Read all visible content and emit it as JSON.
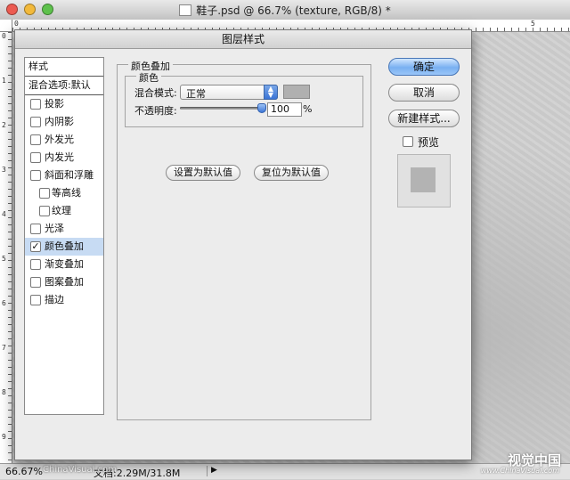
{
  "window": {
    "title": "鞋子.psd @ 66.7% (texture, RGB/8) *",
    "close_color": "#ec5b51",
    "minimize_color": "#f2b93b",
    "zoom_color": "#5ec14c"
  },
  "rulers": {
    "top_labels": [
      "0",
      "5"
    ],
    "left_labels": [
      "0",
      "1",
      "2",
      "3",
      "4",
      "5",
      "6",
      "7",
      "8",
      "9"
    ]
  },
  "status_bar": {
    "zoom": "66.67%",
    "doc_info": "文档:2.29M/31.8M",
    "arrow": "▶"
  },
  "watermarks": {
    "brand": "视觉中国",
    "url": "www.ChinaVisual.com",
    "small": "ChinaVisual.com"
  },
  "dialog": {
    "title": "图层样式",
    "style_list": {
      "header": "样式",
      "blend_options": "混合选项:默认",
      "items": [
        {
          "label": "投影",
          "checked": false,
          "sub": false,
          "selected": false
        },
        {
          "label": "内阴影",
          "checked": false,
          "sub": false,
          "selected": false
        },
        {
          "label": "外发光",
          "checked": false,
          "sub": false,
          "selected": false
        },
        {
          "label": "内发光",
          "checked": false,
          "sub": false,
          "selected": false
        },
        {
          "label": "斜面和浮雕",
          "checked": false,
          "sub": false,
          "selected": false
        },
        {
          "label": "等高线",
          "checked": false,
          "sub": true,
          "selected": false
        },
        {
          "label": "纹理",
          "checked": false,
          "sub": true,
          "selected": false
        },
        {
          "label": "光泽",
          "checked": false,
          "sub": false,
          "selected": false
        },
        {
          "label": "颜色叠加",
          "checked": true,
          "sub": false,
          "selected": true
        },
        {
          "label": "渐变叠加",
          "checked": false,
          "sub": false,
          "selected": false
        },
        {
          "label": "图案叠加",
          "checked": false,
          "sub": false,
          "selected": false
        },
        {
          "label": "描边",
          "checked": false,
          "sub": false,
          "selected": false
        }
      ]
    },
    "color_overlay": {
      "group_title": "颜色叠加",
      "sub_title": "颜色",
      "blend_mode_label": "混合模式:",
      "blend_mode_value": "正常",
      "overlay_color": "#b0b0b0",
      "opacity_label": "不透明度:",
      "opacity_value": "100",
      "opacity_fraction": 1.0,
      "opacity_unit": "%",
      "set_default": "设置为默认值",
      "reset_default": "复位为默认值"
    },
    "buttons": {
      "ok": "确定",
      "cancel": "取消",
      "new_style": "新建样式...",
      "preview_label": "预览"
    }
  }
}
